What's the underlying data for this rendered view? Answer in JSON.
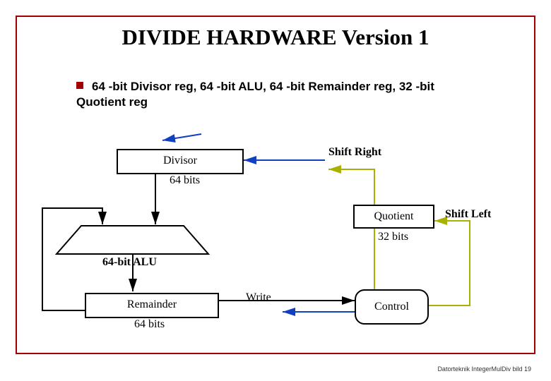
{
  "title": "DIVIDE HARDWARE Version 1",
  "bullet": "64 -bit Divisor reg, 64 -bit ALU, 64 -bit Remainder reg,  32 -bit Quotient reg",
  "divisor": {
    "name": "Divisor",
    "bits": "64 bits"
  },
  "shift_right": "Shift Right",
  "alu": "64-bit ALU",
  "quotient": {
    "name": "Quotient",
    "bits": "32 bits"
  },
  "shift_left": "Shift Left",
  "remainder": {
    "name": "Remainder",
    "bits": "64 bits"
  },
  "write": "Write",
  "control": "Control",
  "footer": "Datorteknik IntegerMulDiv bild 19"
}
